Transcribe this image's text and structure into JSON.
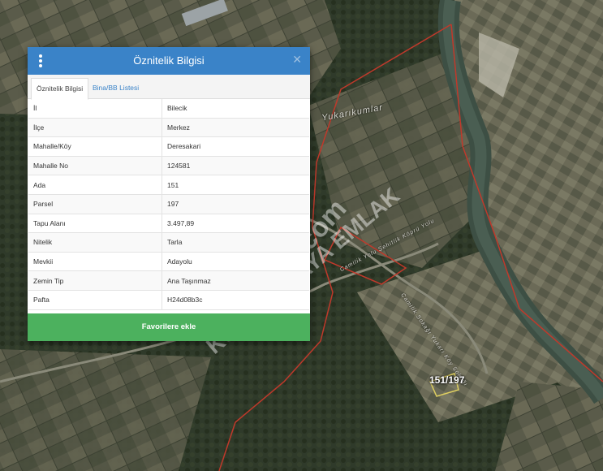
{
  "map": {
    "place_label": "Yukarıkumlar",
    "parcel_label": "151/197",
    "road_labels": [
      "Camilik Yolu Şehitlik Köprü Yolu",
      "Camilik Sokağı Yukarı Köy Sokağı"
    ],
    "boundary_color": "#c0392b"
  },
  "watermark": {
    "line1": "emlakjet.com",
    "line2": "KUZGUNKAYA EMLAK"
  },
  "panel": {
    "title": "Öznitelik Bilgisi",
    "menu_icon": "vertical-dots-icon",
    "close_icon": "close-icon",
    "header_color": "#3a83c8",
    "tabs": [
      {
        "label": "Öznitelik Bilgisi",
        "active": true
      },
      {
        "label": "Bina/BB Listesi",
        "active": false
      }
    ],
    "rows": [
      {
        "key": "İl",
        "value": "Bilecik"
      },
      {
        "key": "İlçe",
        "value": "Merkez"
      },
      {
        "key": "Mahalle/Köy",
        "value": "Deresakari"
      },
      {
        "key": "Mahalle No",
        "value": "124581"
      },
      {
        "key": "Ada",
        "value": "151"
      },
      {
        "key": "Parsel",
        "value": "197"
      },
      {
        "key": "Tapu Alanı",
        "value": "3.497,89"
      },
      {
        "key": "Nitelik",
        "value": "Tarla"
      },
      {
        "key": "Mevkii",
        "value": "Adayolu"
      },
      {
        "key": "Zemin Tip",
        "value": "Ana Taşınmaz"
      },
      {
        "key": "Pafta",
        "value": "H24d08b3c"
      }
    ],
    "favorite_label": "Favorilere ekle",
    "favorite_color": "#4cb15e"
  }
}
